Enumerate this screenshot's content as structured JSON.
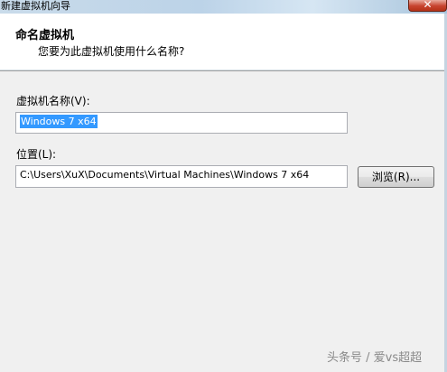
{
  "window": {
    "title": "新建虚拟机向导",
    "close_symbol": "✕"
  },
  "header": {
    "title": "命名虚拟机",
    "subtitle": "您要为此虚拟机使用什么名称?"
  },
  "form": {
    "vm_name_label": "虚拟机名称(V):",
    "vm_name_value": "Windows 7 x64",
    "location_label": "位置(L):",
    "location_value": "C:\\Users\\XuX\\Documents\\Virtual Machines\\Windows 7 x64",
    "browse_label": "浏览(R)..."
  },
  "watermark": "头条号 / 爱vs超超",
  "icons": {
    "close": "close-icon"
  }
}
